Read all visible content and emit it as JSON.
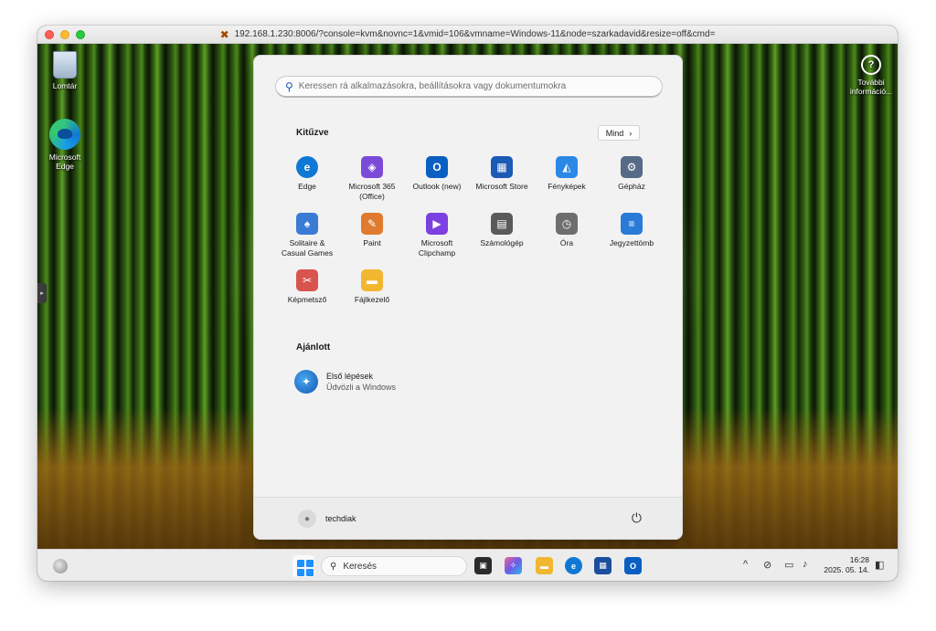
{
  "window": {
    "url": "192.168.1.230:8006/?console=kvm&novnc=1&vmid=106&vmname=Windows-11&node=szarkadavid&resize=off&cmd="
  },
  "desktop": {
    "recycle_bin": "Lomtár",
    "edge_line1": "Microsoft",
    "edge_line2": "Edge",
    "info_line1": "További",
    "info_line2": "információ..."
  },
  "start_menu": {
    "search_placeholder": "Keressen rá alkalmazásokra, beállításokra vagy dokumentumokra",
    "pinned_title": "Kitűzve",
    "all_button": "Mind",
    "pinned": [
      {
        "line1": "Edge",
        "line2": "",
        "icon": "edge-icon",
        "color": "#0f78d4"
      },
      {
        "line1": "Microsoft 365",
        "line2": "(Office)",
        "icon": "microsoft365-icon",
        "color": "#7b4bd8"
      },
      {
        "line1": "Outlook (new)",
        "line2": "",
        "icon": "outlook-icon",
        "color": "#0a5fc2"
      },
      {
        "line1": "Microsoft Store",
        "line2": "",
        "icon": "store-icon",
        "color": "#1b5ab5"
      },
      {
        "line1": "Fényképek",
        "line2": "",
        "icon": "photos-icon",
        "color": "#2a88e6"
      },
      {
        "line1": "Gépház",
        "line2": "",
        "icon": "settings-icon",
        "color": "#566b86"
      },
      {
        "line1": "Solitaire &",
        "line2": "Casual Games",
        "icon": "solitaire-icon",
        "color": "#3a7bd5"
      },
      {
        "line1": "Paint",
        "line2": "",
        "icon": "paint-icon",
        "color": "#e07a2e"
      },
      {
        "line1": "Microsoft",
        "line2": "Clipchamp",
        "icon": "clipchamp-icon",
        "color": "#7c3fe0"
      },
      {
        "line1": "Számológép",
        "line2": "",
        "icon": "calculator-icon",
        "color": "#5a5a5a"
      },
      {
        "line1": "Óra",
        "line2": "",
        "icon": "clock-icon",
        "color": "#6e6e6e"
      },
      {
        "line1": "Jegyzettömb",
        "line2": "",
        "icon": "notepad-icon",
        "color": "#2a7ad8"
      },
      {
        "line1": "Képmetsző",
        "line2": "",
        "icon": "snipping-tool-icon",
        "color": "#d9534f"
      },
      {
        "line1": "Fájlkezelő",
        "line2": "",
        "icon": "file-explorer-icon",
        "color": "#f2b731"
      }
    ],
    "recommended_title": "Ajánlott",
    "recommended": {
      "title": "Első lépések",
      "subtitle": "Üdvözli a Windows"
    },
    "user": "techdiak"
  },
  "taskbar": {
    "search_label": "Keresés",
    "time": "16:28",
    "date": "2025. 05. 14."
  }
}
